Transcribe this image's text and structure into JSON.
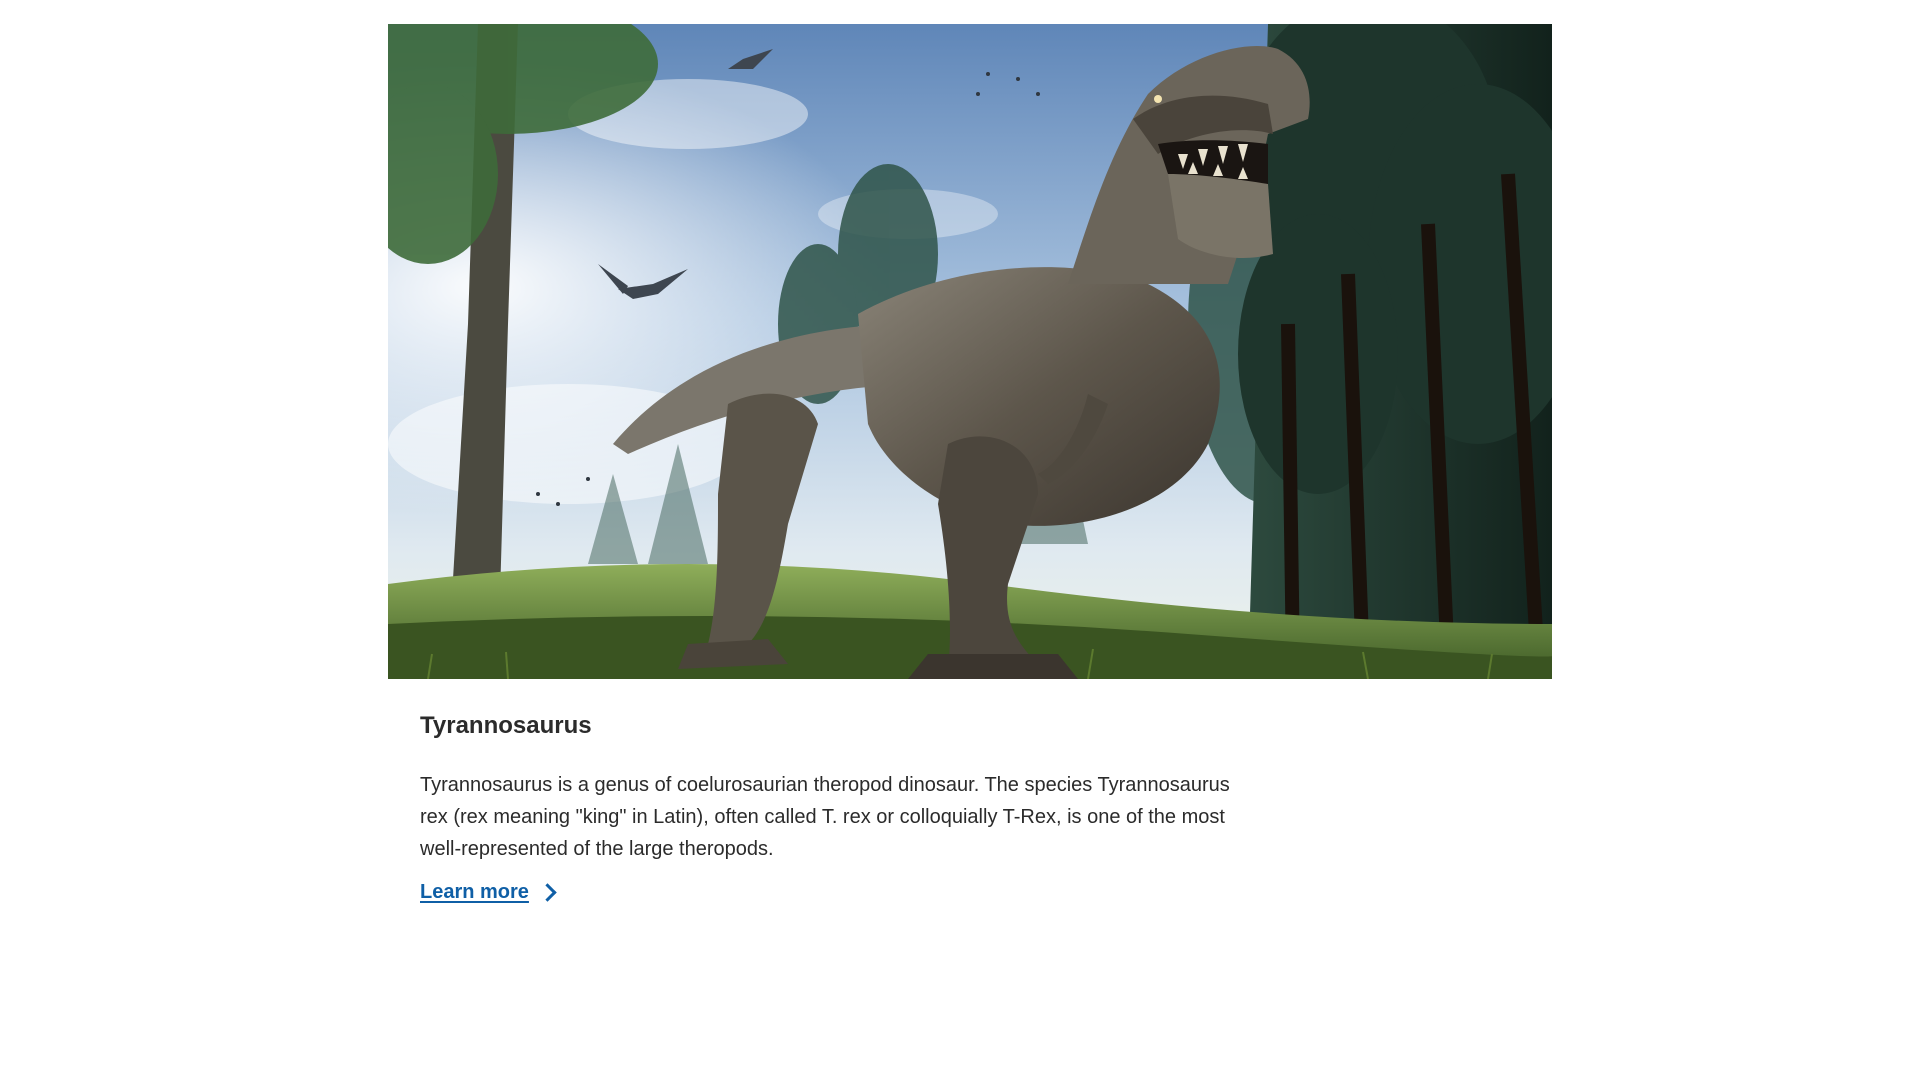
{
  "card": {
    "image_alt": "Tyrannosaurus rex roaring in a forest with flying pterosaurs",
    "title": "Tyrannosaurus",
    "description": "Tyrannosaurus is a genus of coelurosaurian theropod dinosaur. The species Tyrannosaurus rex (rex meaning \"king\" in Latin), often called T. rex or colloquially T-Rex, is one of the most well-represented of the large theropods.",
    "link_label": "Learn more",
    "link_icon": "chevron-right-icon",
    "link_color": "#0f5fa6",
    "text_color": "#2b2b2b"
  }
}
